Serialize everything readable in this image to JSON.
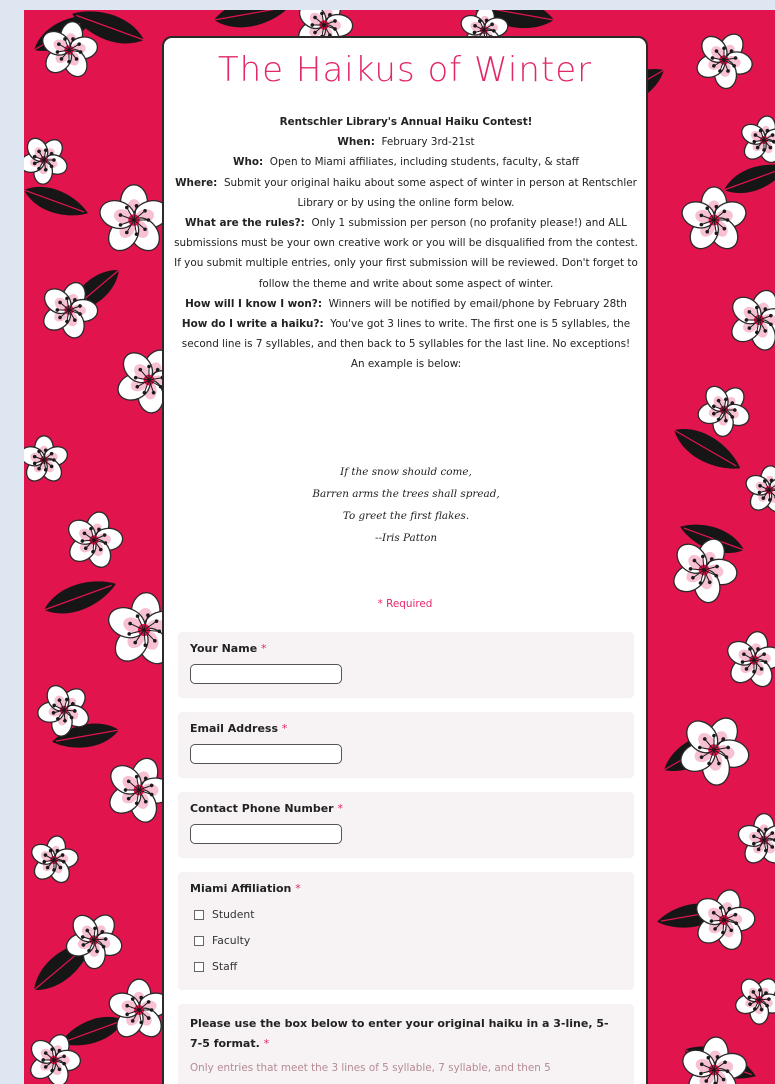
{
  "page": {
    "title": "The Haikus of Winter",
    "colors": {
      "accent": "#e2276a",
      "background_pattern": "#e2144e",
      "card": "#ffffff"
    }
  },
  "intro": {
    "heading": "Rentschler Library's Annual Haiku Contest!",
    "when_label": "When:",
    "when_value": "February 3rd-21st",
    "who_label": "Who:",
    "who_value": "Open to Miami affiliates, including students, faculty, & staff",
    "where_label": "Where:",
    "where_value": "Submit your original haiku about some aspect of winter in person at Rentschler Library or by using the online form below.",
    "rules_label": "What are the rules?:",
    "rules_value": "Only 1 submission per person (no profanity please!) and ALL submissions must be your own creative work or you will be disqualified from the contest. If you submit multiple entries, only your first submission will be reviewed. Don't forget to follow the theme and write about some aspect of winter.",
    "won_label": "How will I know I won?:",
    "won_value": "Winners will be notified by email/phone by February 28th",
    "howto_label": "How do I write a haiku?:",
    "howto_value": "You've got 3 lines to write.  The first one is 5 syllables, the second line is 7 syllables, and then back to 5 syllables for the last line. No exceptions! An example is below:"
  },
  "poem": {
    "line1": "If the snow should come,",
    "line2": "Barren arms the trees shall spread,",
    "line3": "To greet the first flakes.",
    "author": "--Iris Patton"
  },
  "form": {
    "required_note": "* Required",
    "required_mark": "*",
    "name_label": "Your Name",
    "name_value": "",
    "email_label": "Email Address",
    "email_value": "",
    "phone_label": "Contact Phone Number",
    "phone_value": "",
    "affiliation_label": "Miami Affiliation",
    "affiliation_options": [
      "Student",
      "Faculty",
      "Staff"
    ],
    "haiku_label": "Please use the box below to enter your original haiku in a 3-line, 5-7-5 format.",
    "haiku_help": "Only entries that meet the 3 lines of 5 syllable, 7 syllable, and then 5"
  }
}
